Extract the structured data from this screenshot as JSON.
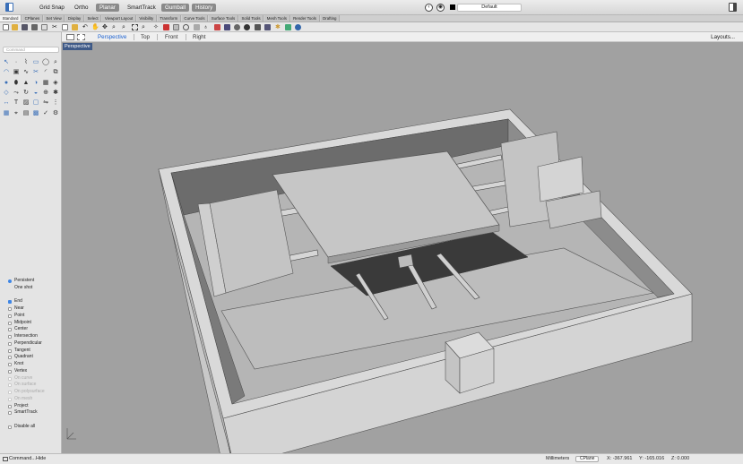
{
  "topbar": {
    "buttons": [
      {
        "label": "Grid Snap",
        "on": false
      },
      {
        "label": "Ortho",
        "on": false
      },
      {
        "label": "Planar",
        "on": true
      },
      {
        "label": "SmartTrack",
        "on": false
      },
      {
        "label": "Gumball",
        "on": true
      },
      {
        "label": "History",
        "on": true
      }
    ],
    "layer": "Default"
  },
  "tabs": [
    "Standard",
    "CPlanes",
    "Set View",
    "Display",
    "Select",
    "Viewport Layout",
    "Visibility",
    "Transform",
    "Curve Tools",
    "Surface Tools",
    "Solid Tools",
    "Mesh Tools",
    "Render Tools",
    "Drafting"
  ],
  "viewport_tabs": {
    "items": [
      "Perspective",
      "Top",
      "Front",
      "Right"
    ],
    "active": "Perspective",
    "layouts": "Layouts..."
  },
  "command_placeholder": "Command",
  "viewport_label": "Perspective",
  "osnap": [
    {
      "label": "Persistent",
      "type": "radio",
      "checked": true
    },
    {
      "label": "One shot",
      "type": "none",
      "checked": false
    },
    {
      "label": "",
      "type": "gap",
      "checked": false
    },
    {
      "label": "End",
      "type": "check",
      "checked": true
    },
    {
      "label": "Near",
      "type": "check",
      "checked": false
    },
    {
      "label": "Point",
      "type": "check",
      "checked": false
    },
    {
      "label": "Midpoint",
      "type": "check",
      "checked": false
    },
    {
      "label": "Center",
      "type": "check",
      "checked": false
    },
    {
      "label": "Intersection",
      "type": "check",
      "checked": false
    },
    {
      "label": "Perpendicular",
      "type": "check",
      "checked": false
    },
    {
      "label": "Tangent",
      "type": "check",
      "checked": false
    },
    {
      "label": "Quadrant",
      "type": "check",
      "checked": false
    },
    {
      "label": "Knot",
      "type": "check",
      "checked": false
    },
    {
      "label": "Vertex",
      "type": "check",
      "checked": false
    },
    {
      "label": "On curve",
      "type": "check",
      "checked": false,
      "dim": true
    },
    {
      "label": "On surface",
      "type": "check",
      "checked": false,
      "dim": true
    },
    {
      "label": "On polysurface",
      "type": "check",
      "checked": false,
      "dim": true
    },
    {
      "label": "On mesh",
      "type": "check",
      "checked": false,
      "dim": true
    },
    {
      "label": "Project",
      "type": "check",
      "checked": false
    },
    {
      "label": "SmartTrack",
      "type": "check",
      "checked": false
    },
    {
      "label": "",
      "type": "gap",
      "checked": false
    },
    {
      "label": "Disable all",
      "type": "check",
      "checked": false
    }
  ],
  "status": {
    "command_toggle": "Command...Hide",
    "units": "Millimeters",
    "cplane": "CPlane",
    "x": "X: -367.961",
    "y": "Y: -165.016",
    "z": "Z: 0.000"
  },
  "colors": {
    "accent": "#3f86e5",
    "viewport_bg": "#a1a1a1",
    "viewport_label_bg": "#3f5a87"
  }
}
